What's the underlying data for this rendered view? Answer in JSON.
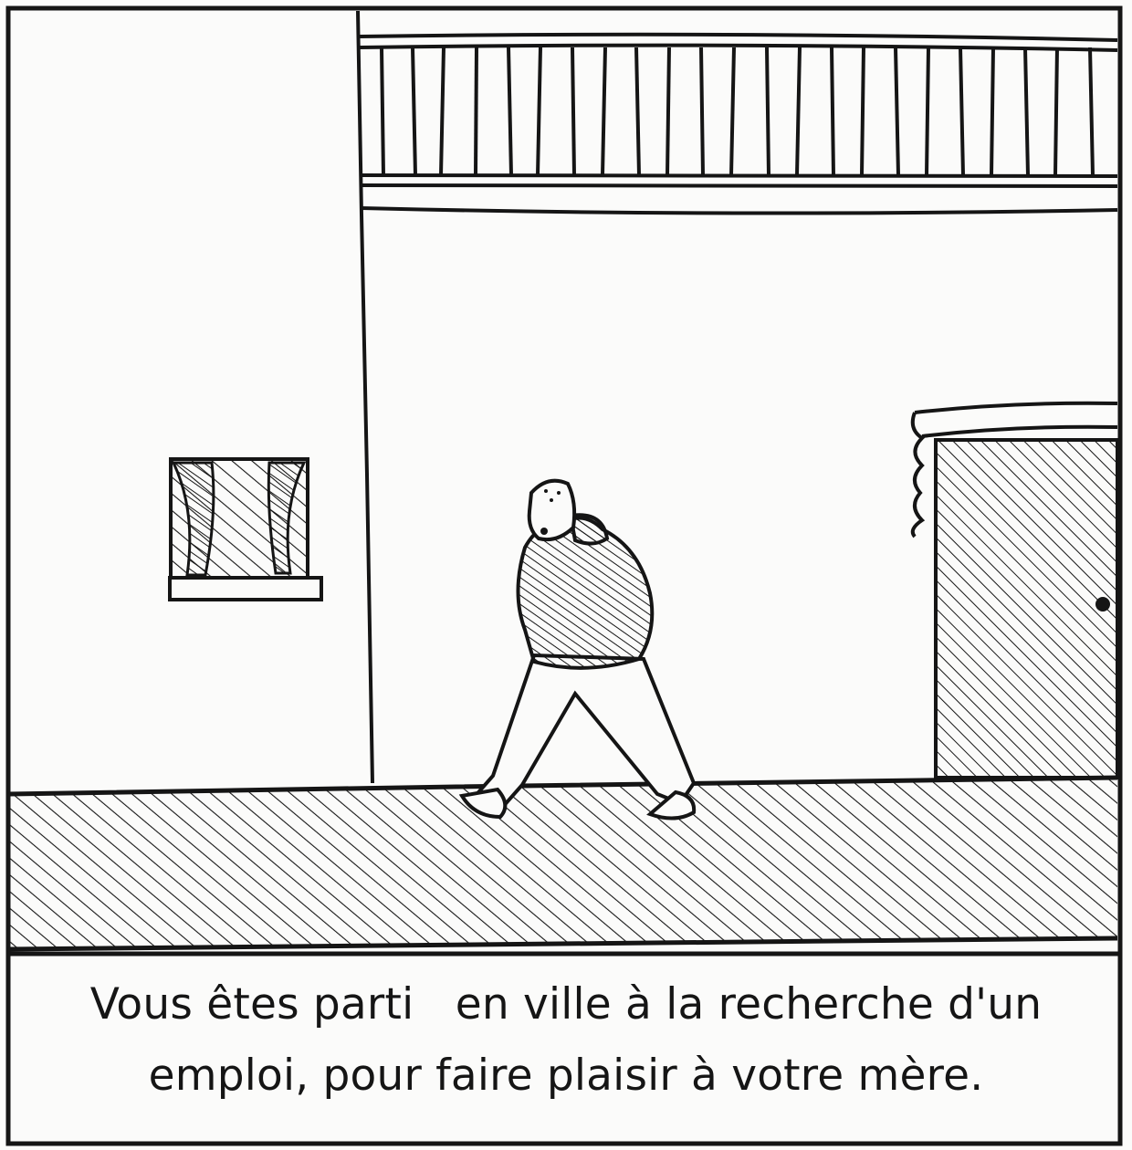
{
  "panel": {
    "caption": {
      "line1": "Vous êtes parti   en ville à la recherche d'un",
      "line2": "emploi, pour faire plaisir à votre mère."
    }
  },
  "colors": {
    "ink": "#151515",
    "paper": "#fbfbfa"
  },
  "icons": [
    "walking-man-figure",
    "window-with-curtains",
    "shaded-doorway",
    "balcony-railing",
    "hatched-sidewalk"
  ]
}
